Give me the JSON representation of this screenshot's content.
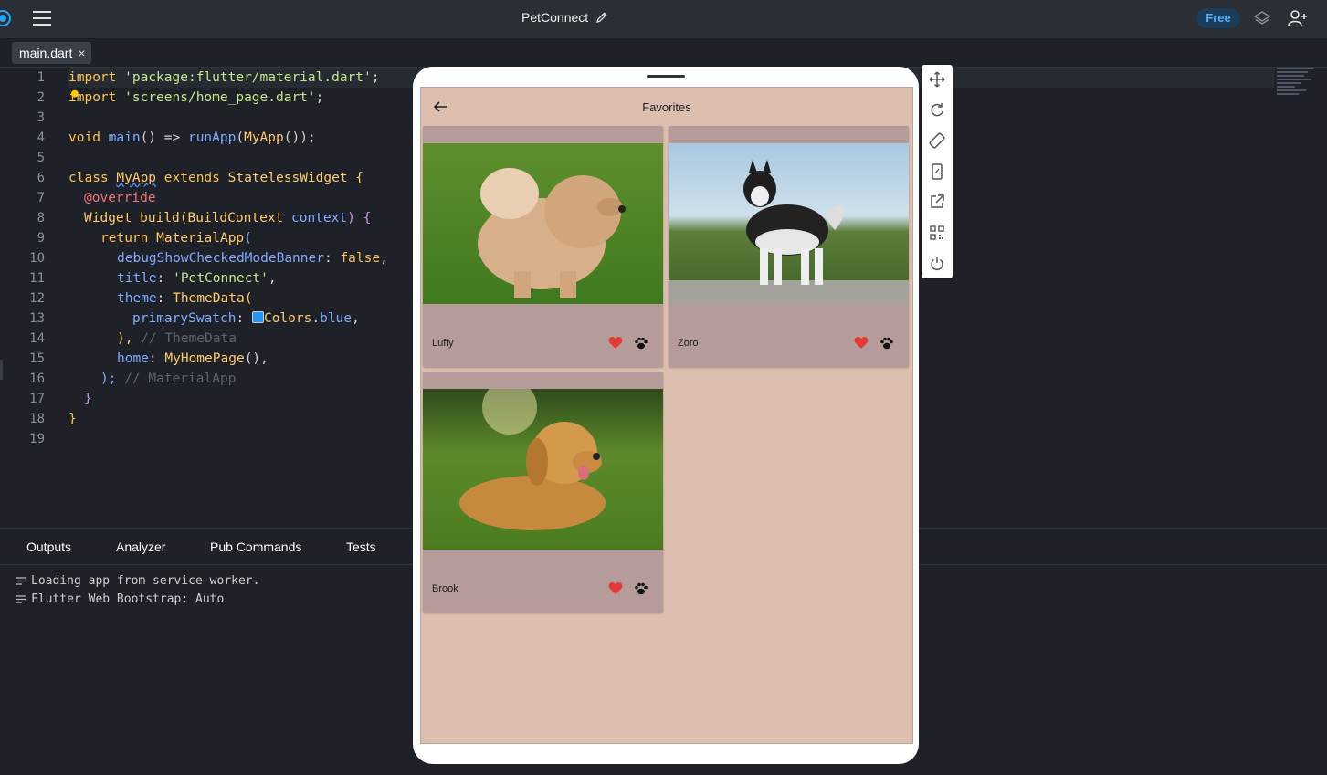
{
  "header": {
    "project_title": "PetConnect",
    "badge": "Free"
  },
  "editor": {
    "tab_label": "main.dart",
    "close_glyph": "×",
    "line_numbers": [
      "1",
      "2",
      "3",
      "4",
      "5",
      "6",
      "7",
      "8",
      "9",
      "10",
      "11",
      "12",
      "13",
      "14",
      "15",
      "16",
      "17",
      "18",
      "19"
    ],
    "code": {
      "l1": [
        "import",
        "'package:flutter/material.dart'",
        ";"
      ],
      "l2": [
        "import",
        "'screens/home_page.dart'",
        ";"
      ],
      "l4": [
        "void",
        "main",
        "() => ",
        "runApp",
        "(",
        "MyApp",
        "());"
      ],
      "l6": [
        "class",
        "MyApp",
        "extends",
        "StatelessWidget",
        " {"
      ],
      "l7": [
        "@override"
      ],
      "l8": [
        "Widget",
        "build",
        "(",
        "BuildContext",
        "context",
        ") {"
      ],
      "l9": [
        "return",
        "MaterialApp",
        "("
      ],
      "l10": [
        "debugShowCheckedModeBanner",
        ": ",
        "false",
        ","
      ],
      "l11": [
        "title",
        ": ",
        "'PetConnect'",
        ","
      ],
      "l12": [
        "theme",
        ": ",
        "ThemeData",
        "("
      ],
      "l13": [
        "primarySwatch",
        ": ",
        "Colors",
        ".",
        "blue",
        ","
      ],
      "l14": [
        "),",
        " // ThemeData"
      ],
      "l15": [
        "home",
        ": ",
        "MyHomePage",
        "(),"
      ],
      "l16": [
        ");",
        " // MaterialApp"
      ],
      "l17": [
        "}"
      ],
      "l18": [
        "}"
      ]
    }
  },
  "panel": {
    "tabs": [
      "Outputs",
      "Analyzer",
      "Pub Commands",
      "Tests"
    ],
    "logs": [
      "Loading app from service worker.",
      "Flutter Web Bootstrap: Auto"
    ]
  },
  "app": {
    "title": "Favorites",
    "pets": [
      {
        "name": "Luffy",
        "photo": "fluffy chow chow dog on grass"
      },
      {
        "name": "Zoro",
        "photo": "black and white husky standing"
      },
      {
        "name": "Brook",
        "photo": "golden retriever lying in grass"
      }
    ]
  },
  "colors": {
    "accent": "#29a3f2",
    "screen_bg": "#ddbfaf",
    "card_bg": "#b59c9b",
    "heart": "#e53935"
  },
  "icons": {
    "toolbar": [
      "move-icon",
      "rotate-icon",
      "rotate-device-icon",
      "phone-frame-icon",
      "open-external-icon",
      "qr-code-icon",
      "power-icon"
    ]
  }
}
